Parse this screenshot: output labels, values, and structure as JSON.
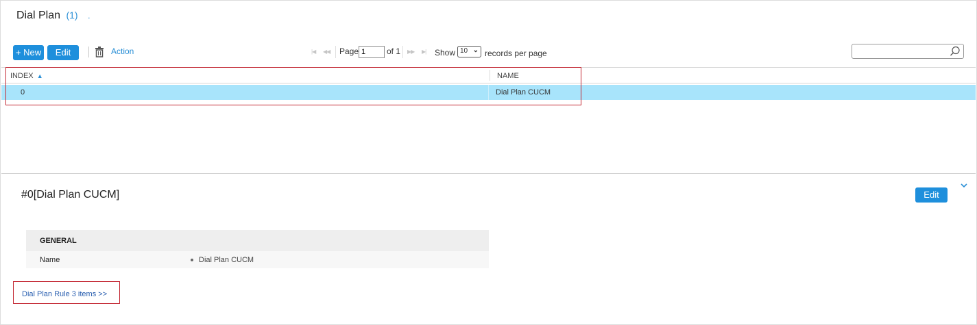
{
  "header": {
    "title": "Dial Plan",
    "count": "(1)",
    "dot": "."
  },
  "toolbar": {
    "new_label": "+ New",
    "edit_label": "Edit",
    "action_label": "Action"
  },
  "pager": {
    "page_label": "Page",
    "page_value": "1",
    "of_label": "of 1",
    "show_label": "Show",
    "records_per_page_value": "10",
    "records_per_page_label": "records per page"
  },
  "search": {
    "placeholder": ""
  },
  "table": {
    "columns": [
      "INDEX",
      "NAME"
    ],
    "rows": [
      {
        "index": "0",
        "name": "Dial Plan CUCM",
        "selected": true
      }
    ]
  },
  "detail": {
    "title": "#0[Dial Plan CUCM]",
    "edit_label": "Edit",
    "section_header": "GENERAL",
    "fields": [
      {
        "label": "Name",
        "value": "Dial Plan CUCM"
      }
    ],
    "link_label": "Dial Plan Rule 3 items >>"
  },
  "colors": {
    "accent": "#1e8fdc",
    "selected_row": "#a8e4fb",
    "highlight_box": "#c22430"
  }
}
